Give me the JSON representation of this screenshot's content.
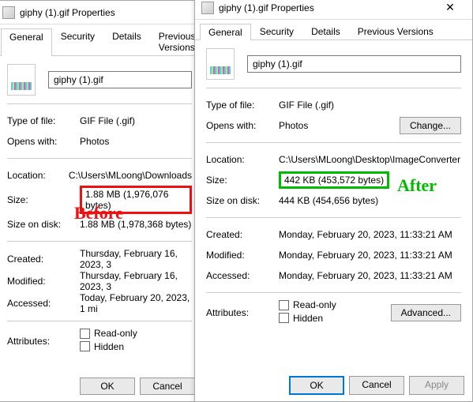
{
  "left": {
    "title": "giphy (1).gif Properties",
    "tabs": [
      "General",
      "Security",
      "Details",
      "Previous Versions"
    ],
    "filename": "giphy (1).gif",
    "type_label": "Type of file:",
    "type_value": "GIF File (.gif)",
    "opens_label": "Opens with:",
    "opens_value": "Photos",
    "location_label": "Location:",
    "location_value": "C:\\Users\\MLoong\\Downloads",
    "size_label": "Size:",
    "size_value": "1.88 MB (1,976,076 bytes)",
    "disk_label": "Size on disk:",
    "disk_value": "1.88 MB (1,978,368 bytes)",
    "created_label": "Created:",
    "created_value": "Thursday, February 16, 2023, 3",
    "modified_label": "Modified:",
    "modified_value": "Thursday, February 16, 2023, 3",
    "accessed_label": "Accessed:",
    "accessed_value": "Today, February 20, 2023, 1 mi",
    "attr_label": "Attributes:",
    "readonly": "Read-only",
    "hidden": "Hidden",
    "ok": "OK",
    "cancel": "Cancel"
  },
  "right": {
    "title": "giphy (1).gif Properties",
    "tabs": [
      "General",
      "Security",
      "Details",
      "Previous Versions"
    ],
    "filename": "giphy (1).gif",
    "type_label": "Type of file:",
    "type_value": "GIF File (.gif)",
    "opens_label": "Opens with:",
    "opens_value": "Photos",
    "change_btn": "Change...",
    "location_label": "Location:",
    "location_value": "C:\\Users\\MLoong\\Desktop\\ImageConverter",
    "size_label": "Size:",
    "size_value": "442 KB (453,572 bytes)",
    "disk_label": "Size on disk:",
    "disk_value": "444 KB (454,656 bytes)",
    "created_label": "Created:",
    "created_value": "Monday, February 20, 2023, 11:33:21 AM",
    "modified_label": "Modified:",
    "modified_value": "Monday, February 20, 2023, 11:33:21 AM",
    "accessed_label": "Accessed:",
    "accessed_value": "Monday, February 20, 2023, 11:33:21 AM",
    "attr_label": "Attributes:",
    "readonly": "Read-only",
    "hidden": "Hidden",
    "advanced_btn": "Advanced...",
    "ok": "OK",
    "cancel": "Cancel",
    "apply": "Apply"
  },
  "overlays": {
    "before": "Before",
    "after": "After"
  }
}
